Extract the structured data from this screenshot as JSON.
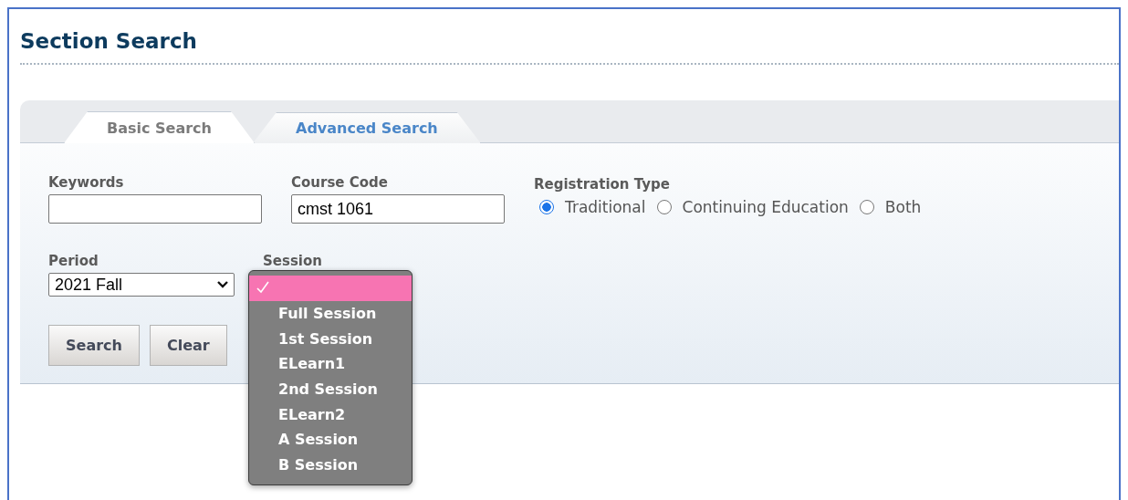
{
  "page": {
    "title": "Section Search"
  },
  "tabs": [
    {
      "label": "Basic Search",
      "selected": true
    },
    {
      "label": "Advanced Search",
      "selected": false
    }
  ],
  "form": {
    "keywords": {
      "label": "Keywords"
    },
    "course_code": {
      "label": "Course Code",
      "value": "cmst 1061"
    },
    "registration_type": {
      "label": "Registration Type",
      "options": [
        {
          "label": "Traditional",
          "selected": true
        },
        {
          "label": "Continuing Education",
          "selected": false
        },
        {
          "label": "Both",
          "selected": false
        }
      ]
    },
    "period": {
      "label": "Period",
      "value": "2021 Fall"
    },
    "session": {
      "label": "Session",
      "expanded": true,
      "options": [
        {
          "selected": true
        },
        {
          "label": "Full Session",
          "selected": false
        },
        {
          "label": "1st Session",
          "selected": false
        },
        {
          "label": "ELearn1",
          "selected": false
        },
        {
          "label": "2nd Session",
          "selected": false
        },
        {
          "label": "ELearn2",
          "selected": false
        },
        {
          "label": "A Session",
          "selected": false
        },
        {
          "label": "B Session",
          "selected": false
        }
      ]
    }
  },
  "buttons": [
    "Search",
    "Clear"
  ]
}
